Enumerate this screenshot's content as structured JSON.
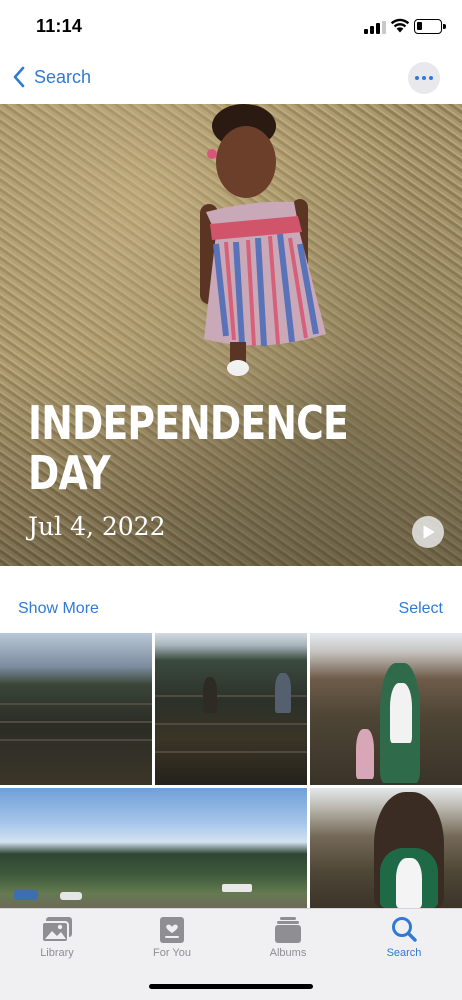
{
  "status_bar": {
    "time": "11:14",
    "icons": [
      "cellular-signal-icon",
      "wifi-icon",
      "battery-icon"
    ]
  },
  "nav": {
    "back_label": "Search",
    "back_icon": "chevron-left-icon",
    "more_icon": "ellipsis-icon"
  },
  "memory": {
    "title": "INDEPENDENCE DAY",
    "date": "Jul 4, 2022",
    "play_icon": "play-icon"
  },
  "section": {
    "show_more_label": "Show More",
    "select_label": "Select"
  },
  "tab_bar": {
    "tabs": [
      {
        "label": "Library",
        "icon": "photo-library-icon",
        "active": false
      },
      {
        "label": "For You",
        "icon": "for-you-icon",
        "active": false
      },
      {
        "label": "Albums",
        "icon": "albums-icon",
        "active": false
      },
      {
        "label": "Search",
        "icon": "search-icon",
        "active": true
      }
    ]
  },
  "colors": {
    "accent": "#2f7ad6",
    "inactive_tab": "#8e8e93",
    "tab_bar_background": "#f0f0f2"
  }
}
